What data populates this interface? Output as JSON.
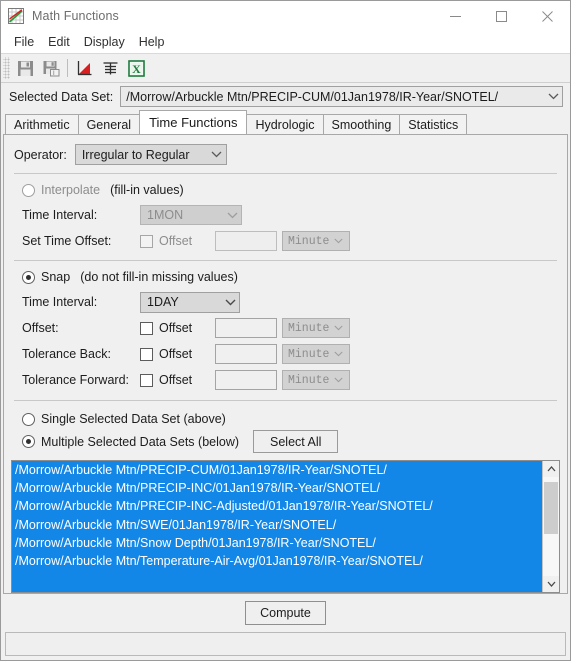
{
  "window": {
    "title": "Math Functions",
    "icon": "chart-plot-icon",
    "buttons": {
      "minimize": "minimize-icon",
      "maximize": "maximize-icon",
      "close": "close-icon"
    }
  },
  "menubar": {
    "items": [
      "File",
      "Edit",
      "Display",
      "Help"
    ]
  },
  "toolbar": {
    "buttons": [
      {
        "name": "save-icon",
        "label": "Save"
      },
      {
        "name": "save-as-icon",
        "label": "Save As"
      },
      {
        "name": "plot-chart-icon",
        "label": "Plot"
      },
      {
        "name": "tabulate-icon",
        "label": "Tabulate"
      },
      {
        "name": "excel-export-icon",
        "label": "Export to Excel"
      }
    ]
  },
  "selected_data_set": {
    "label": "Selected Data Set:",
    "value": "/Morrow/Arbuckle Mtn/PRECIP-CUM/01Jan1978/IR-Year/SNOTEL/"
  },
  "tabs": [
    {
      "label": "Arithmetic",
      "active": false
    },
    {
      "label": "General",
      "active": false
    },
    {
      "label": "Time Functions",
      "active": true
    },
    {
      "label": "Hydrologic",
      "active": false
    },
    {
      "label": "Smoothing",
      "active": false
    },
    {
      "label": "Statistics",
      "active": false
    }
  ],
  "operator": {
    "label": "Operator:",
    "value": "Irregular to Regular"
  },
  "interpolate": {
    "radio_label": "Interpolate",
    "radio_note": "(fill-in values)",
    "selected": false,
    "enabled": false,
    "time_interval": {
      "label": "Time Interval:",
      "value": "1MON"
    },
    "set_time_offset": {
      "label": "Set Time Offset:",
      "checkbox_label": "Offset",
      "checked": false,
      "text_value": "",
      "unit": "Minute"
    }
  },
  "snap": {
    "radio_label": "Snap",
    "radio_note": "(do not fill-in missing values)",
    "selected": true,
    "time_interval": {
      "label": "Time Interval:",
      "value": "1DAY"
    },
    "rows": [
      {
        "label": "Offset:",
        "checkbox_label": "Offset",
        "checked": false,
        "text_value": "",
        "unit": "Minute"
      },
      {
        "label": "Tolerance Back:",
        "checkbox_label": "Offset",
        "checked": false,
        "text_value": "",
        "unit": "Minute"
      },
      {
        "label": "Tolerance Forward:",
        "checkbox_label": "Offset",
        "checked": false,
        "text_value": "",
        "unit": "Minute"
      }
    ]
  },
  "selection": {
    "single_label": "Single Selected Data Set (above)",
    "single_selected": false,
    "multiple_label": "Multiple Selected Data Sets (below)",
    "multiple_selected": true,
    "select_all_label": "Select All",
    "list_items": [
      "/Morrow/Arbuckle Mtn/PRECIP-CUM/01Jan1978/IR-Year/SNOTEL/",
      "/Morrow/Arbuckle Mtn/PRECIP-INC/01Jan1978/IR-Year/SNOTEL/",
      "/Morrow/Arbuckle Mtn/PRECIP-INC-Adjusted/01Jan1978/IR-Year/SNOTEL/",
      "/Morrow/Arbuckle Mtn/SWE/01Jan1978/IR-Year/SNOTEL/",
      "/Morrow/Arbuckle Mtn/Snow Depth/01Jan1978/IR-Year/SNOTEL/",
      "/Morrow/Arbuckle Mtn/Temperature-Air-Avg/01Jan1978/IR-Year/SNOTEL/"
    ]
  },
  "footer": {
    "compute_label": "Compute",
    "status_text": ""
  },
  "colors": {
    "selection_blue": "#1287e8",
    "panel_bg": "#f0f0f0",
    "disabled_text": "#8d8d8d",
    "excel_green": "#1f7a3d",
    "chart_red": "#d91f1f"
  }
}
